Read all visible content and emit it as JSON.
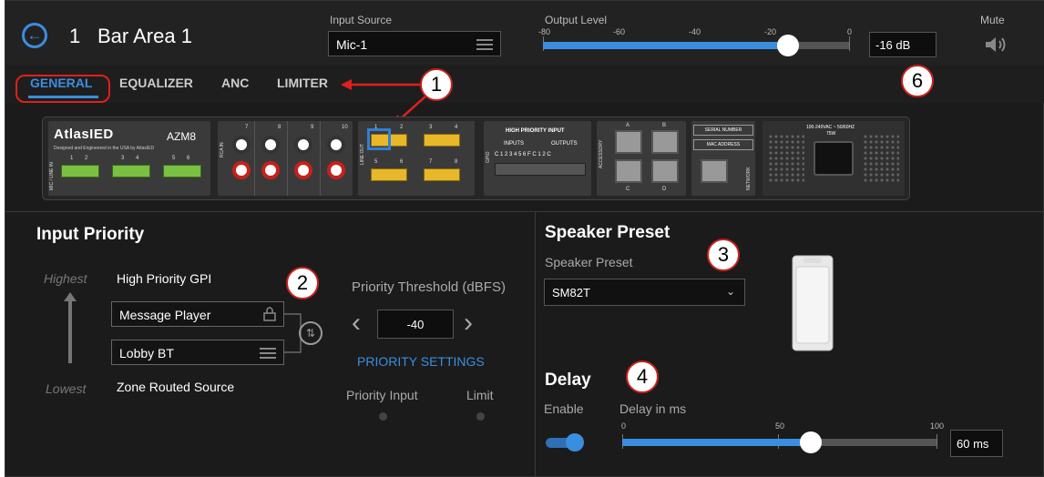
{
  "header": {
    "zone_number": "1",
    "zone_name": "Bar Area 1",
    "input_source_label": "Input Source",
    "input_source_value": "Mic-1",
    "output_level_label": "Output Level",
    "output_level_ticks": [
      "-80",
      "-60",
      "-40",
      "-20",
      "0"
    ],
    "output_level_db": -16,
    "output_level_value": "-16 dB",
    "mute_label": "Mute"
  },
  "tabs": [
    "GENERAL",
    "EQUALIZER",
    "ANC",
    "LIMITER"
  ],
  "annotations": [
    "1",
    "2",
    "3",
    "4",
    "6"
  ],
  "device": {
    "brand": "AtlasIED",
    "tagline": "Designed and Engineered in the USA by AtlasIED",
    "model": "AZM8",
    "mic_line_in_label": "MIC / LINE IN",
    "mic_channels": [
      "1",
      "2",
      "3",
      "4",
      "5",
      "6"
    ],
    "rca_in_label": "RCA IN",
    "rca_channels": [
      "7",
      "8",
      "9",
      "10"
    ],
    "line_out_label": "LINE OUT",
    "line_out_channels": [
      "1",
      "2",
      "3",
      "4",
      "5",
      "6",
      "7",
      "8"
    ],
    "gpio_label": "GPIO",
    "high_priority_input": "HIGH PRIORITY INPUT",
    "inputs_label": "INPUTS",
    "outputs_label": "OUTPUTS",
    "gpio_pins": "C 1 2 3 4 5 6 F C 1 2 C",
    "accessory_label": "ACCESSORY",
    "accessory_ports": [
      "A",
      "B",
      "C",
      "D"
    ],
    "serial_number": "SERIAL NUMBER",
    "mac_address": "MAC ADDRESS",
    "network_label": "NETWORK",
    "power_line1": "100-240VAC ~ 50/60HZ",
    "power_line2": "75W"
  },
  "input_priority": {
    "title": "Input Priority",
    "highest": "Highest",
    "lowest": "Lowest",
    "high_priority_gpi": "High Priority GPI",
    "slot1": "Message Player",
    "slot2": "Lobby BT",
    "zone_routed": "Zone Routed Source",
    "threshold_label": "Priority Threshold (dBFS)",
    "threshold_value": "-40",
    "priority_settings": "PRIORITY SETTINGS",
    "priority_input_label": "Priority Input",
    "limit_label": "Limit"
  },
  "speaker_preset": {
    "title": "Speaker Preset",
    "label": "Speaker Preset",
    "value": "SM82T"
  },
  "delay": {
    "title": "Delay",
    "enable_label": "Enable",
    "enabled": true,
    "delay_label": "Delay in ms",
    "ticks": [
      "0",
      "50",
      "100"
    ],
    "delay_ms": 60,
    "value": "60 ms"
  },
  "colors": {
    "accent": "#3a8ee0",
    "annotation": "#c8201c",
    "terminal_green": "#7ac043",
    "terminal_yellow": "#e8b82a"
  }
}
